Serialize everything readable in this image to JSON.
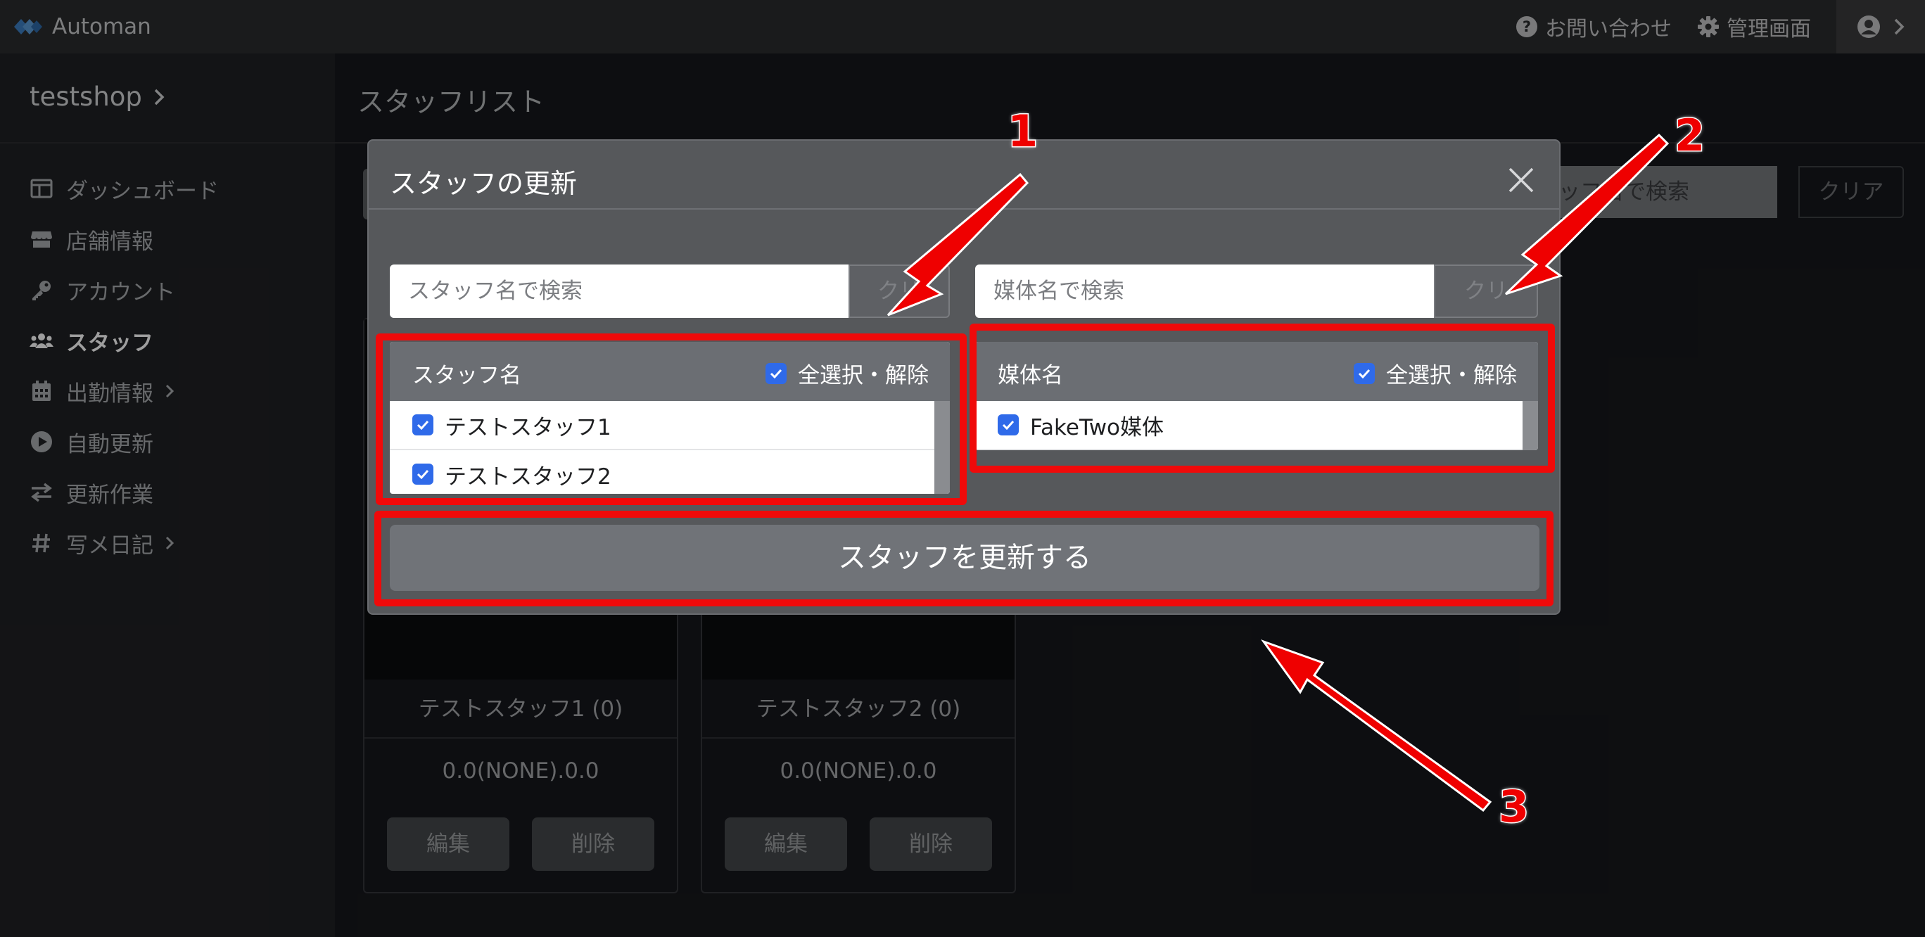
{
  "app": {
    "name": "Automan"
  },
  "topbar": {
    "contact": "お問い合わせ",
    "admin": "管理画面"
  },
  "sidebar": {
    "shop": "testshop",
    "items": [
      {
        "label": "ダッシュボード",
        "icon": "layout-icon"
      },
      {
        "label": "店舗情報",
        "icon": "store-icon"
      },
      {
        "label": "アカウント",
        "icon": "key-icon"
      },
      {
        "label": "スタッフ",
        "icon": "users-icon",
        "active": true
      },
      {
        "label": "出勤情報",
        "icon": "calendar-icon",
        "has_chevron": true
      },
      {
        "label": "自動更新",
        "icon": "play-circle-icon"
      },
      {
        "label": "更新作業",
        "icon": "exchange-icon"
      },
      {
        "label": "写メ日記",
        "icon": "hashtag-icon",
        "has_chevron": true
      }
    ]
  },
  "main": {
    "title": "スタッフリスト",
    "search_placeholder_partial": "タッフ名で検索",
    "clear_label": "クリア",
    "cards": [
      {
        "name": "テストスタッフ1 (0)",
        "value": "0.0(NONE).0.0",
        "edit": "編集",
        "delete": "削除"
      },
      {
        "name": "テストスタッフ2 (0)",
        "value": "0.0(NONE).0.0",
        "edit": "編集",
        "delete": "削除"
      }
    ]
  },
  "modal": {
    "title": "スタッフの更新",
    "staff_search_placeholder": "スタッフ名で検索",
    "staff_clear_partial": "クリ",
    "media_search_placeholder": "媒体名で検索",
    "media_clear_partial": "クリ",
    "staff_list": {
      "header": "スタッフ名",
      "toggle_all": "全選択・解除",
      "items": [
        {
          "name": "テストスタッフ1",
          "checked": true
        },
        {
          "name": "テストスタッフ2",
          "checked": true
        }
      ]
    },
    "media_list": {
      "header": "媒体名",
      "toggle_all": "全選択・解除",
      "items": [
        {
          "name": "FakeTwo媒体",
          "checked": true
        }
      ]
    },
    "submit": "スタッフを更新する"
  },
  "annotations": {
    "one": "1",
    "two": "2",
    "three": "3"
  },
  "colors": {
    "annotation_red": "#f00a0a",
    "checkbox_blue": "#2f6ae9"
  }
}
